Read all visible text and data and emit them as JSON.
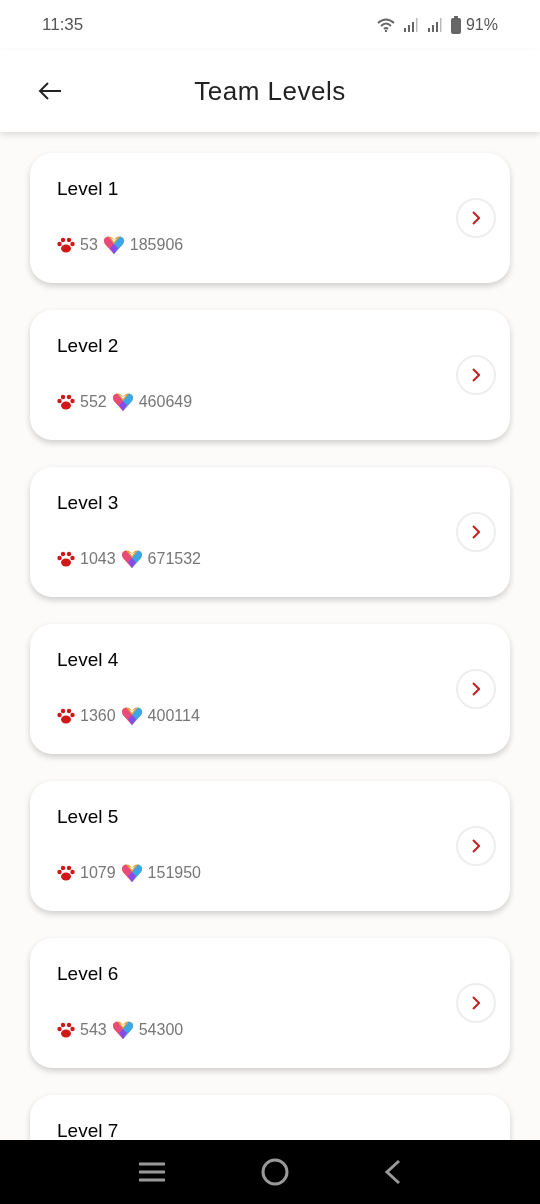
{
  "status_bar": {
    "time": "11:35",
    "battery": "91%"
  },
  "header": {
    "title": "Team Levels"
  },
  "levels": [
    {
      "title": "Level 1",
      "members": "53",
      "points": "185906"
    },
    {
      "title": "Level 2",
      "members": "552",
      "points": "460649"
    },
    {
      "title": "Level 3",
      "members": "1043",
      "points": "671532"
    },
    {
      "title": "Level 4",
      "members": "1360",
      "points": "400114"
    },
    {
      "title": "Level 5",
      "members": "1079",
      "points": "151950"
    },
    {
      "title": "Level 6",
      "members": "543",
      "points": "54300"
    },
    {
      "title": "Level 7"
    }
  ]
}
